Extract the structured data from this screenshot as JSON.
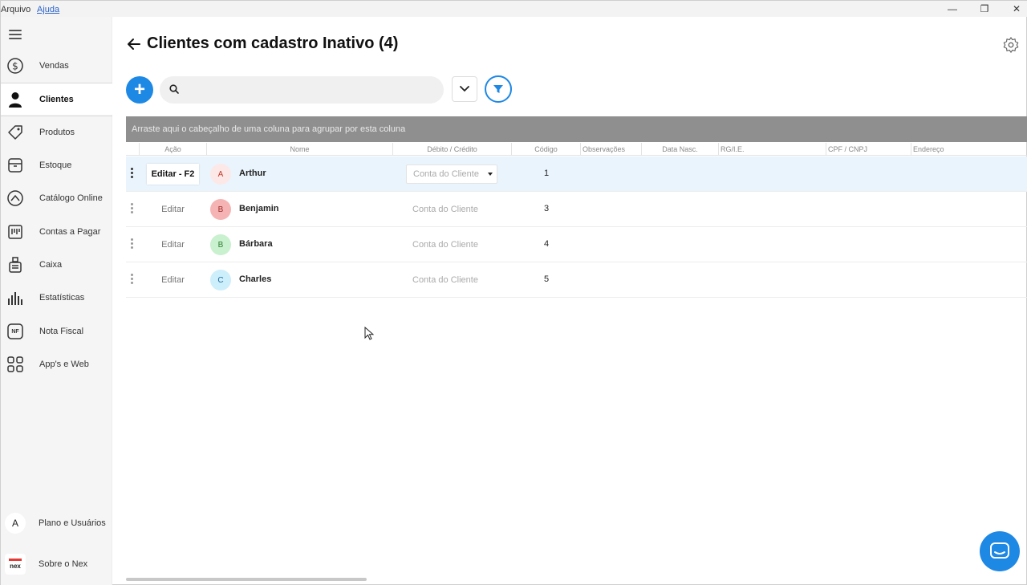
{
  "menubar": {
    "items": [
      "Arquivo",
      "Ajuda"
    ]
  },
  "window": {
    "minimize": "—",
    "restore": "❐",
    "close": "✕"
  },
  "sidebar": {
    "items": [
      {
        "label": "Vendas",
        "icon": "dollar-icon"
      },
      {
        "label": "Clientes",
        "icon": "person-icon",
        "active": true
      },
      {
        "label": "Produtos",
        "icon": "tag-icon"
      },
      {
        "label": "Estoque",
        "icon": "box-icon"
      },
      {
        "label": "Catálogo Online",
        "icon": "catalog-icon"
      },
      {
        "label": "Contas a Pagar",
        "icon": "bills-icon"
      },
      {
        "label": "Caixa",
        "icon": "cash-register-icon"
      },
      {
        "label": "Estatísticas",
        "icon": "bar-chart-icon"
      },
      {
        "label": "Nota Fiscal",
        "icon": "nf-icon",
        "badge": "NF"
      },
      {
        "label": "App's e Web",
        "icon": "grid-icon"
      }
    ],
    "plan": {
      "label": "Plano e Usuários",
      "avatar": "A"
    },
    "about": {
      "label": "Sobre o Nex",
      "logo": "nex"
    }
  },
  "header": {
    "title": "Clientes com cadastro Inativo (4)"
  },
  "search": {
    "placeholder": "",
    "value": ""
  },
  "grid": {
    "group_hint": "Arraste aqui o cabeçalho de uma coluna para agrupar por esta coluna",
    "columns": [
      "Ação",
      "Nome",
      "Débito / Crédito",
      "Código",
      "Observações",
      "Data Nasc.",
      "RG/I.E.",
      "CPF / CNPJ",
      "Endereço"
    ],
    "rows": [
      {
        "action": "Editar - F2",
        "initial": "A",
        "name": "Arthur",
        "account": "Conta do Cliente",
        "code": "1",
        "selected": true,
        "avatar_bg": "#fde8e8",
        "avatar_fg": "#c0392b"
      },
      {
        "action": "Editar",
        "initial": "B",
        "name": "Benjamin",
        "account": "Conta do Cliente",
        "code": "3",
        "selected": false,
        "avatar_bg": "#f6b3b3",
        "avatar_fg": "#9b2c2c"
      },
      {
        "action": "Editar",
        "initial": "B",
        "name": "Bárbara",
        "account": "Conta do Cliente",
        "code": "4",
        "selected": false,
        "avatar_bg": "#c9f0cf",
        "avatar_fg": "#2e7d32"
      },
      {
        "action": "Editar",
        "initial": "C",
        "name": "Charles",
        "account": "Conta do Cliente",
        "code": "5",
        "selected": false,
        "avatar_bg": "#cdeefb",
        "avatar_fg": "#1e6f9a"
      }
    ]
  },
  "colors": {
    "accent": "#1e88e5",
    "group_bar": "#8f8f8f",
    "selected_row": "#eaf4fd"
  }
}
